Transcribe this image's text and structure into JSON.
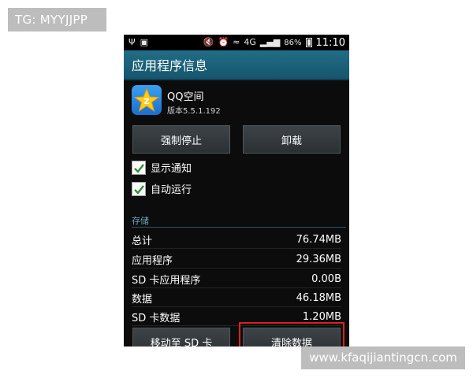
{
  "top_tag": "TG: MYYJJPP",
  "watermark": "www.kfaqijiantingcn.com",
  "status_bar": {
    "battery": "86%",
    "time": "11:10",
    "network": "4G"
  },
  "header": {
    "title": "应用程序信息"
  },
  "app": {
    "name": "QQ空间",
    "version": "版本5.5.1.192",
    "icon": "qzone-star-icon"
  },
  "buttons": {
    "force_stop": "强制停止",
    "uninstall": "卸载",
    "move_to_sd": "移动至 SD 卡",
    "clear_data": "清除数据"
  },
  "checkboxes": [
    {
      "label": "显示通知",
      "checked": true
    },
    {
      "label": "自动运行",
      "checked": true
    }
  ],
  "storage": {
    "title": "存储",
    "rows": [
      {
        "label": "总计",
        "value": "76.74MB"
      },
      {
        "label": "应用程序",
        "value": "29.36MB"
      },
      {
        "label": "SD 卡应用程序",
        "value": "0.00B"
      },
      {
        "label": "数据",
        "value": "46.18MB"
      },
      {
        "label": "SD 卡数据",
        "value": "1.20MB"
      }
    ]
  },
  "colors": {
    "action_bar": "#1a5f78",
    "section_title": "#6aa5bc",
    "highlight": "#e01e1e",
    "checkmark": "#2f8f3a"
  }
}
